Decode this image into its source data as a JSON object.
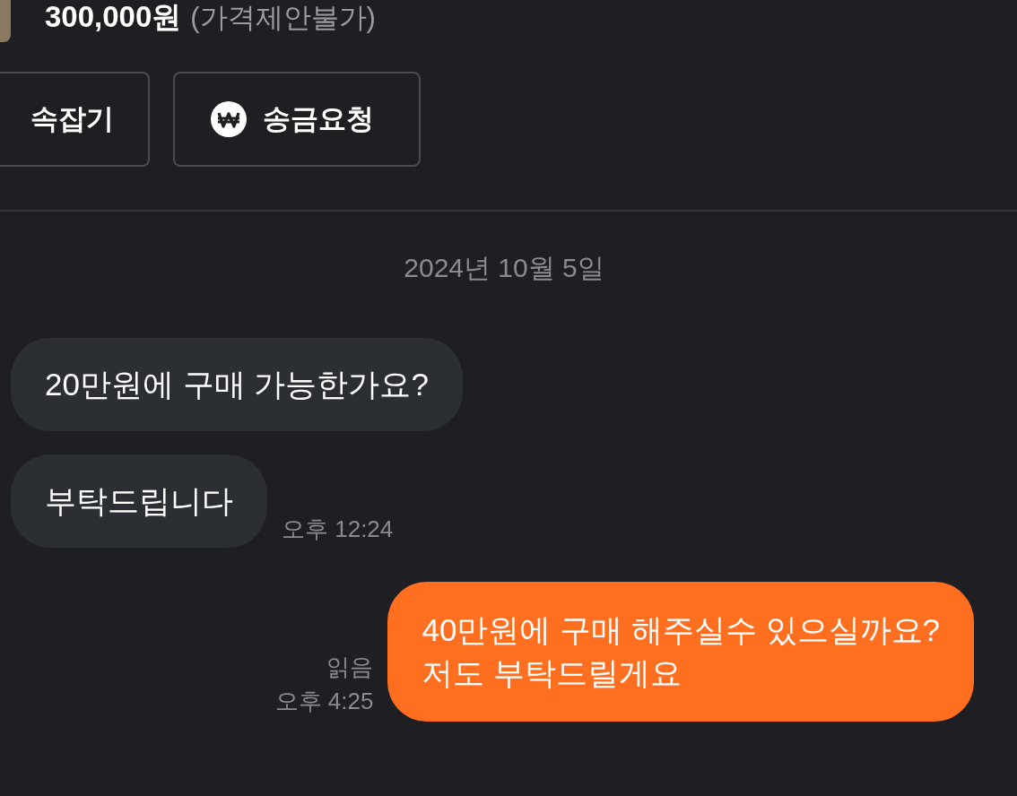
{
  "product": {
    "price": "300,000원",
    "price_note": "(가격제안불가)"
  },
  "actions": [
    {
      "label": "속잡기",
      "kind": "plain"
    },
    {
      "label": "송금요청",
      "kind": "won"
    }
  ],
  "date": "2024년 10월 5일",
  "messages": [
    {
      "kind": "incoming",
      "lines": [
        "20만원에 구매 가능한가요?"
      ]
    },
    {
      "kind": "incoming",
      "lines": [
        "부탁드립니다"
      ],
      "time": "오후 12:24"
    },
    {
      "kind": "outgoing",
      "lines": [
        "40만원에 구매 해주실수 있으실까요?",
        "저도 부탁드릴게요"
      ],
      "read": "읽음",
      "time": "오후 4:25"
    }
  ]
}
